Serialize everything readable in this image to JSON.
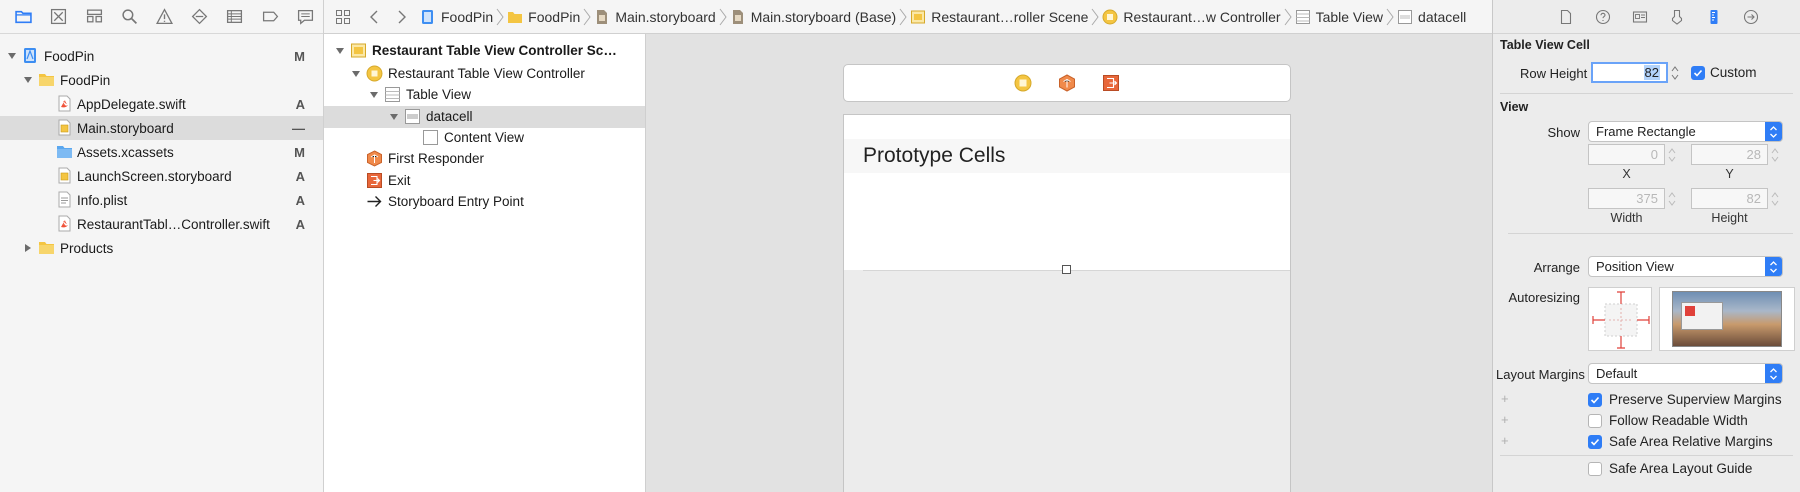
{
  "colors": {
    "accent": "#2f7df6",
    "folder": "#f4c542",
    "swift": "#f05138",
    "constraint": "#e0413a"
  },
  "navigator": {
    "toolbar_icons": [
      "folder-icon",
      "source-control-icon",
      "symbol-icon",
      "find-icon",
      "issue-icon",
      "test-icon",
      "debug-icon",
      "breakpoint-icon",
      "report-icon"
    ],
    "items": [
      {
        "label": "FoodPin",
        "status": "M",
        "kind": "project",
        "level": 0,
        "expanded": true
      },
      {
        "label": "FoodPin",
        "status": "",
        "kind": "folder",
        "level": 1,
        "expanded": true
      },
      {
        "label": "AppDelegate.swift",
        "status": "A",
        "kind": "swift",
        "level": 2
      },
      {
        "label": "Main.storyboard",
        "status": "—",
        "kind": "storyboard",
        "level": 2,
        "selected": true
      },
      {
        "label": "Assets.xcassets",
        "status": "M",
        "kind": "assets",
        "level": 2
      },
      {
        "label": "LaunchScreen.storyboard",
        "status": "A",
        "kind": "storyboard",
        "level": 2
      },
      {
        "label": "Info.plist",
        "status": "A",
        "kind": "plist",
        "level": 2
      },
      {
        "label": "RestaurantTabl…Controller.swift",
        "status": "A",
        "kind": "swift",
        "level": 2
      },
      {
        "label": "Products",
        "status": "",
        "kind": "folder",
        "level": 1,
        "expanded": false
      }
    ]
  },
  "jumpbar": {
    "crumbs": [
      "FoodPin",
      "FoodPin",
      "Main.storyboard",
      "Main.storyboard (Base)",
      "Restaurant…roller Scene",
      "Restaurant…w Controller",
      "Table View",
      "datacell"
    ]
  },
  "outline": {
    "items": [
      {
        "label": "Restaurant Table View Controller Sc…",
        "bold": true
      },
      {
        "label": "Restaurant Table View Controller"
      },
      {
        "label": "Table View"
      },
      {
        "label": "datacell",
        "selected": true
      },
      {
        "label": "Content View"
      },
      {
        "label": "First Responder"
      },
      {
        "label": "Exit"
      },
      {
        "label": "Storyboard Entry Point"
      }
    ]
  },
  "canvas": {
    "prototype_title": "Prototype Cells"
  },
  "inspector": {
    "table_view_cell": {
      "title": "Table View Cell",
      "row_height_label": "Row Height",
      "row_height": "82",
      "custom_label": "Custom",
      "custom_checked": true
    },
    "view": {
      "title": "View",
      "show_label": "Show",
      "show_value": "Frame Rectangle",
      "x": "0",
      "y": "28",
      "width": "375",
      "height": "82",
      "x_label": "X",
      "y_label": "Y",
      "width_label": "Width",
      "height_label": "Height",
      "arrange_label": "Arrange",
      "arrange_value": "Position View",
      "autoresizing_label": "Autoresizing",
      "layout_margins_label": "Layout Margins",
      "layout_margins_value": "Default",
      "preserve_label": "Preserve Superview Margins",
      "preserve_checked": true,
      "readable_label": "Follow Readable Width",
      "readable_checked": false,
      "safe_margins_label": "Safe Area Relative Margins",
      "safe_margins_checked": true,
      "safe_guide_label": "Safe Area Layout Guide",
      "safe_guide_checked": false
    }
  }
}
